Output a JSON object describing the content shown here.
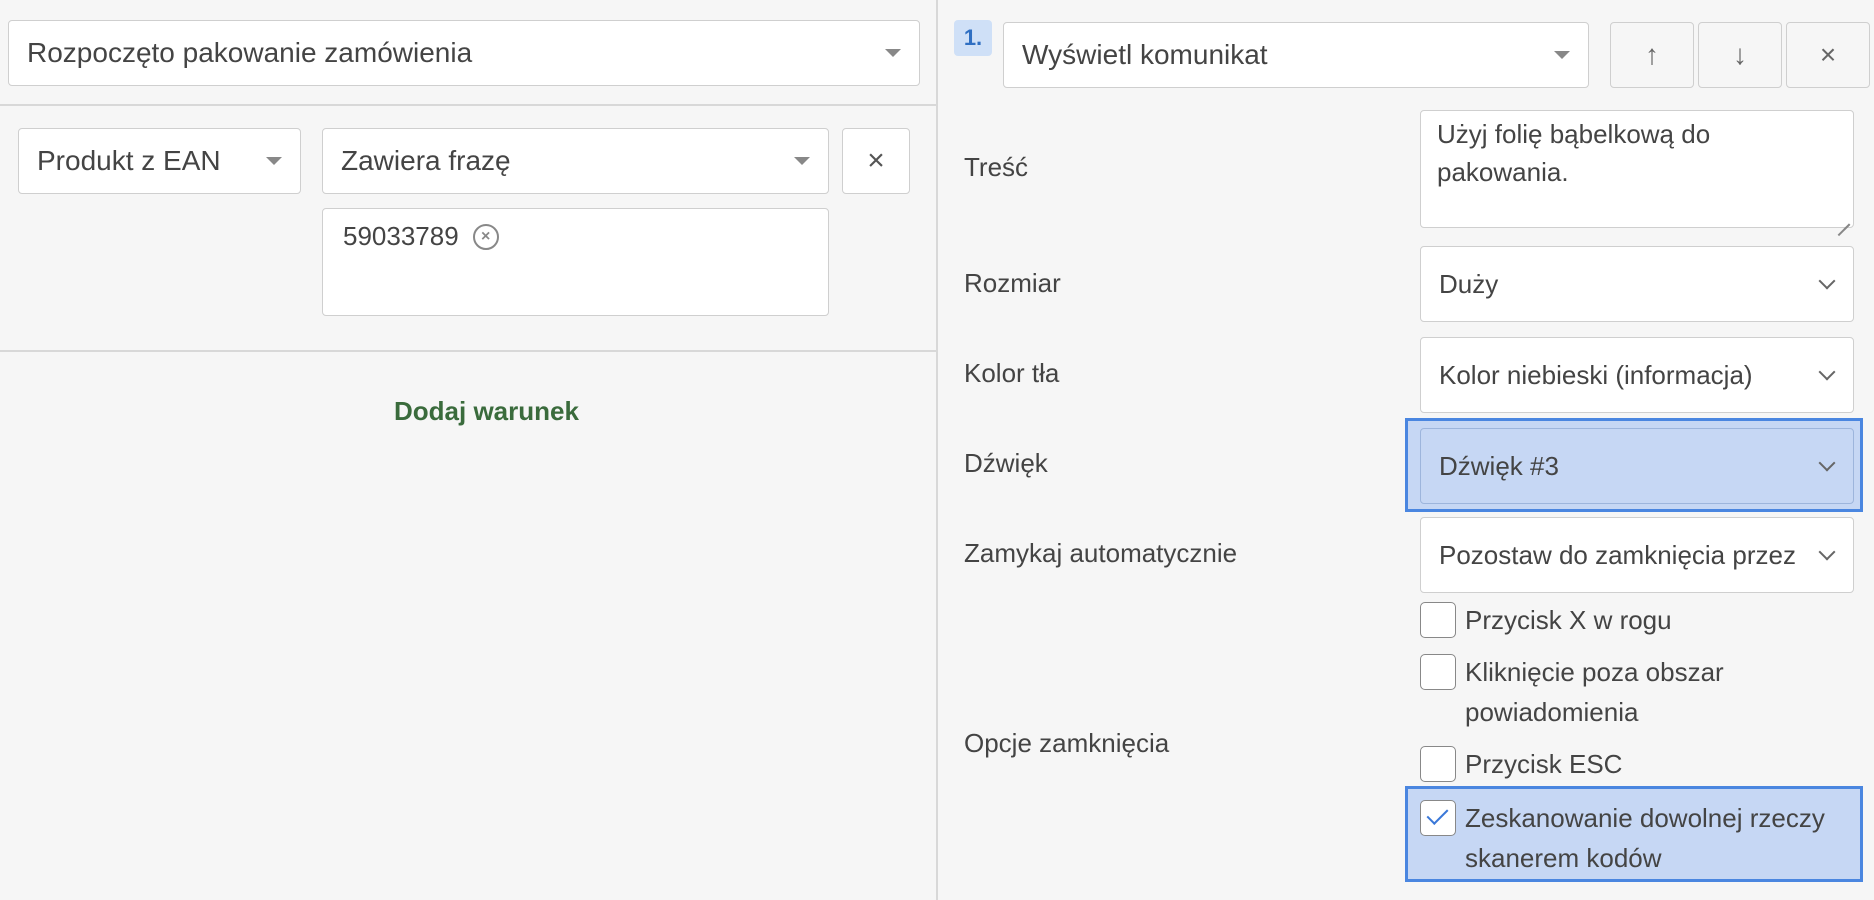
{
  "trigger": {
    "event_value": "Rozpoczęto pakowanie zamówienia"
  },
  "condition": {
    "field_value": "Produkt z EAN",
    "operator_value": "Zawiera frazę",
    "remove_label": "×",
    "tags": [
      "59033789"
    ],
    "add_condition_label": "Dodaj warunek"
  },
  "action": {
    "step_number": "1.",
    "type_value": "Wyświetl komunikat",
    "move_up_label": "↑",
    "move_down_label": "↓",
    "remove_label": "×",
    "content_label": "Treść",
    "content_value": "Użyj folię bąbelkową do pakowania.",
    "size_label": "Rozmiar",
    "size_value": "Duży",
    "bg_color_label": "Kolor tła",
    "bg_color_value": "Kolor niebieski (informacja)",
    "sound_label": "Dźwięk",
    "sound_value": "Dźwięk #3",
    "autoclose_label": "Zamykaj automatycznie",
    "autoclose_value": "Pozostaw do zamknięcia przez",
    "close_options_label": "Opcje zamknięcia",
    "close_options": [
      {
        "label": "Przycisk X w rogu",
        "checked": false
      },
      {
        "label": "Kliknięcie poza obszar powiadomienia",
        "checked": false
      },
      {
        "label": "Przycisk ESC",
        "checked": false
      },
      {
        "label": "Zeskanowanie dowolnej rzeczy skanerem kodów",
        "checked": true
      }
    ]
  },
  "colors": {
    "accent": "#4a86e0",
    "highlight_bg": "#c6d7f4",
    "link_green": "#3a6b3c"
  }
}
